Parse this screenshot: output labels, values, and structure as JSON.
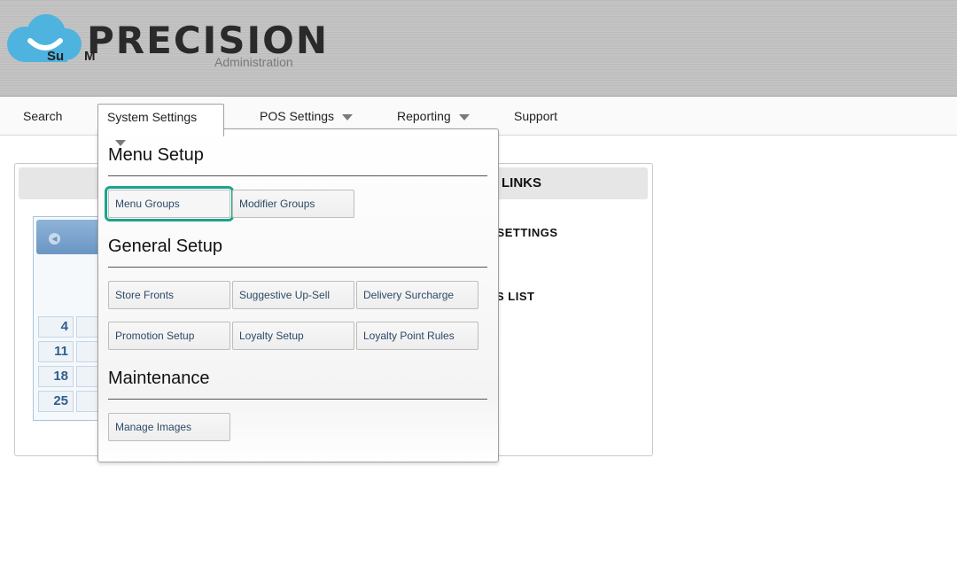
{
  "header": {
    "logo_text": "PRECISION",
    "logo_subtitle": "Administration",
    "logo_color": "#4fb3e0"
  },
  "nav": {
    "items": [
      {
        "label": "Search",
        "has_caret": false
      },
      {
        "label": "System Settings",
        "has_caret": true,
        "active": true
      },
      {
        "label": "POS Settings",
        "has_caret": true
      },
      {
        "label": "Reporting",
        "has_caret": true
      },
      {
        "label": "Support",
        "has_caret": false
      }
    ]
  },
  "dropdown": {
    "sections": [
      {
        "title": "Menu Setup",
        "items": [
          "Menu Groups",
          "Modifier Groups"
        ]
      },
      {
        "title": "General Setup",
        "items": [
          "Store Fronts",
          "Suggestive Up-Sell",
          "Delivery Surcharge",
          "Promotion Setup",
          "Loyalty Setup",
          "Loyalty Point Rules"
        ]
      },
      {
        "title": "Maintenance",
        "items": [
          "Manage Images"
        ]
      }
    ],
    "highlighted_item": "Menu Groups",
    "highlight_color": "#1aa58a"
  },
  "background": {
    "links_title": "LINKS",
    "settings_link": "T SETTINGS",
    "list_link": "S LIST",
    "calendar": {
      "days_of_week": [
        "Su",
        "M"
      ],
      "dates": [
        "4",
        "11",
        "18",
        "25"
      ]
    }
  }
}
